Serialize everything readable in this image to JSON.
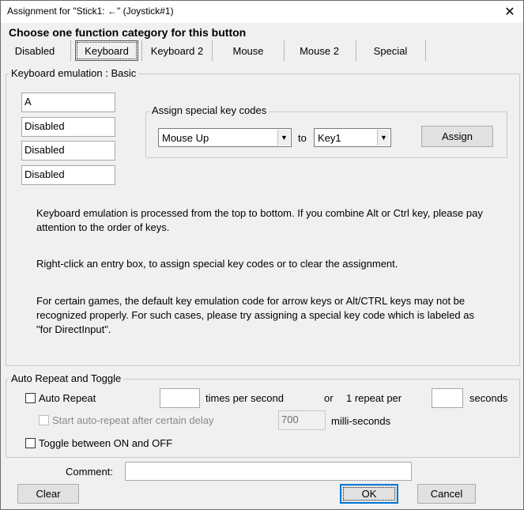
{
  "window": {
    "title": "Assignment for \"Stick1: ←\" (Joystick#1)",
    "close_symbol": "✕"
  },
  "heading": "Choose one function category for this button",
  "tabs": [
    {
      "label": "Disabled",
      "active": false
    },
    {
      "label": "Keyboard",
      "active": true
    },
    {
      "label": "Keyboard 2",
      "active": false
    },
    {
      "label": "Mouse",
      "active": false
    },
    {
      "label": "Mouse 2",
      "active": false
    },
    {
      "label": "Special",
      "active": false
    }
  ],
  "keyboard_group": {
    "label": "Keyboard emulation : Basic",
    "entries": [
      "A",
      "Disabled",
      "Disabled",
      "Disabled"
    ],
    "special_group": {
      "label": "Assign special key codes",
      "from_value": "Mouse Up",
      "to_label": "to",
      "to_value": "Key1",
      "assign_label": "Assign"
    },
    "paragraphs": [
      "Keyboard emulation is processed from the top to bottom.  If you combine Alt or Ctrl key, please pay attention to the order of keys.",
      "Right-click an entry box, to assign special key codes or to clear the assignment.",
      "For certain games, the default key emulation code for arrow keys or Alt/CTRL keys may not be recognized properly.  For such cases, please try assigning a special key code which is labeled as \"for DirectInput\"."
    ]
  },
  "auto_repeat_group": {
    "label": "Auto Repeat and Toggle",
    "auto_repeat_label": "Auto Repeat",
    "auto_repeat_checked": false,
    "times_value": "",
    "times_label": "times per second",
    "or_label": "or",
    "one_repeat_label": "1 repeat per",
    "seconds_value": "",
    "seconds_label": "seconds",
    "delay_label": "Start auto-repeat after certain delay",
    "delay_checked": false,
    "delay_value": "700",
    "delay_unit": "milli-seconds",
    "toggle_label": "Toggle between ON and OFF",
    "toggle_checked": false
  },
  "footer": {
    "comment_label": "Comment:",
    "comment_value": "",
    "clear_label": "Clear",
    "ok_label": "OK",
    "cancel_label": "Cancel"
  },
  "colors": {
    "dialog_bg": "#f0f0f0",
    "default_button_border": "#0078d7"
  },
  "icons": {
    "close": "close-icon",
    "dropdown": "chevron-down-icon"
  }
}
